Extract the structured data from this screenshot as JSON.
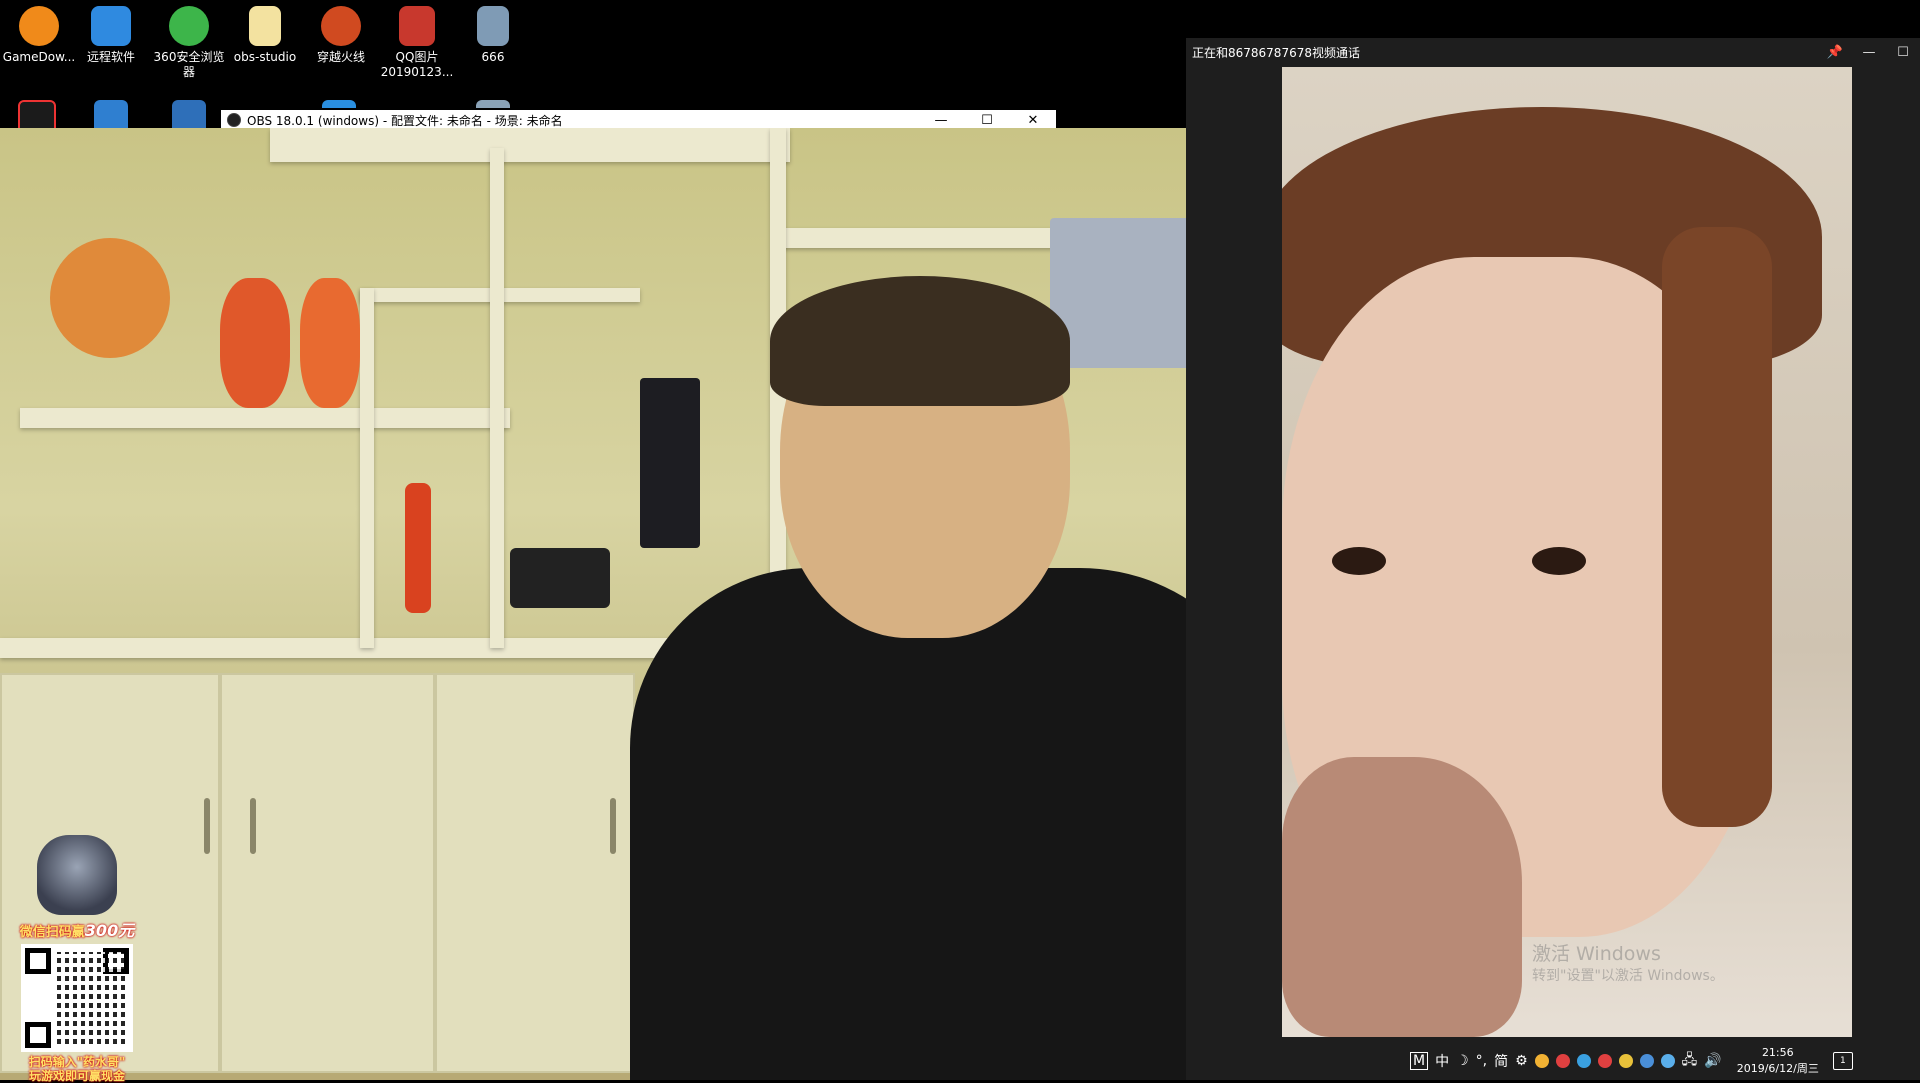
{
  "desktop": {
    "icons": [
      {
        "label": "GameDow...",
        "color": "#f08a1a"
      },
      {
        "label": "远程软件",
        "color": "#2f8ae0"
      },
      {
        "label": "360安全浏览器",
        "color": "#3db54a"
      },
      {
        "label": "obs-studio",
        "color": "#f3e2a0"
      },
      {
        "label": "穿越火线",
        "color": "#d04a20"
      },
      {
        "label": "QQ图片20190123...",
        "color": "#c8382d"
      },
      {
        "label": "666",
        "color": "#7f9bb5"
      }
    ],
    "row2_icons": [
      {
        "name": "qq-icon",
        "color": "#1b1b1b"
      },
      {
        "name": "remote-app-icon",
        "color": "#2f7fd0"
      },
      {
        "name": "security-icon",
        "color": "#2e6fb9"
      },
      {
        "name": "app-icon-4",
        "color": "#2a8fe0"
      },
      {
        "name": "app-icon-5",
        "color": "#c9c9c9"
      },
      {
        "name": "app-icon-6",
        "color": "#8aa3b8"
      }
    ]
  },
  "obs_window": {
    "title": "OBS 18.0.1 (windows) - 配置文件: 未命名 - 场景: 未命名",
    "minimize": "—",
    "maximize": "☐",
    "close": "✕"
  },
  "ad": {
    "top_text": "微信扫码赢",
    "amount": "300元",
    "bottom_line1": "扫码输入\"药水哥\"",
    "bottom_line2": "玩游戏即可赢现金"
  },
  "call_window": {
    "title": "正在和86786787678视频通话",
    "pin": "📌",
    "minimize": "—",
    "maximize": "☐"
  },
  "watermark": {
    "line1": "激活 Windows",
    "line2": "转到\"设置\"以激活 Windows。"
  },
  "taskbar": {
    "ime_m": "M",
    "ime_lang": "中",
    "ime_moon": "☽",
    "ime_punct": "°,",
    "ime_simp": "简",
    "ime_gear": "⚙",
    "time": "21:56",
    "date": "2019/6/12/周三",
    "notifications": "1",
    "tray_colors": [
      "#f2b233",
      "#e04040",
      "#3aa0e0",
      "#e04040",
      "#e8c13a",
      "#4a8fd8",
      "#5aaeea"
    ]
  }
}
